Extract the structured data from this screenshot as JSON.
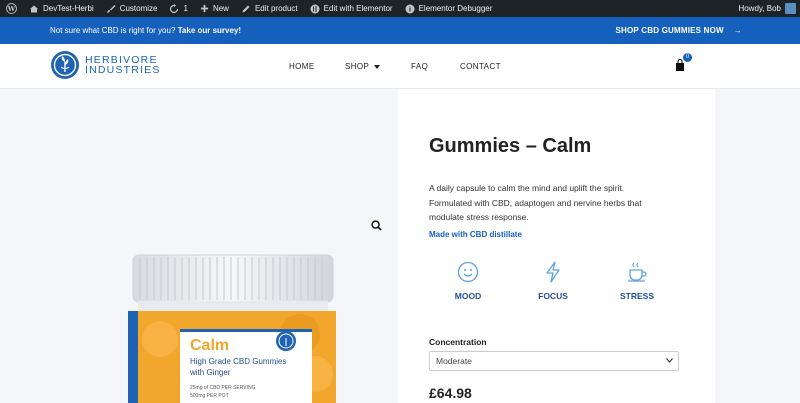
{
  "admin_bar": {
    "site_name": "DevTest-Herbi",
    "customize": "Customize",
    "updates_count": "1",
    "new": "New",
    "edit_product": "Edit product",
    "edit_elementor": "Edit with Elementor",
    "elementor_debugger": "Elementor Debugger",
    "howdy": "Howdy, Bob"
  },
  "promo": {
    "question": "Not sure what CBD is right for you?",
    "survey_link": "Take our survey!",
    "cta": "SHOP CBD GUMMIES NOW",
    "cta_arrow": "→"
  },
  "header": {
    "logo_line1": "HERBIVORE",
    "logo_line2": "INDUSTRIES",
    "nav": {
      "home": "HOME",
      "shop": "SHOP",
      "faq": "FAQ",
      "contact": "CONTACT"
    },
    "cart_count": "0"
  },
  "product": {
    "title": "Gummies – Calm",
    "description": "A daily capsule to calm the mind and uplift the spirit. Formulated with CBD, adaptogen and nervine herbs that modulate stress response.",
    "distillate_label": "Made with CBD distillate",
    "benefits": [
      {
        "label": "MOOD",
        "icon": "smile-icon"
      },
      {
        "label": "FOCUS",
        "icon": "lightning-icon"
      },
      {
        "label": "STRESS",
        "icon": "tea-cup-icon"
      }
    ],
    "concentration_label": "Concentration",
    "concentration_value": "Moderate",
    "price": "£64.98",
    "jar": {
      "name": "Calm",
      "subtitle_line1": "High Grade CBD Gummies",
      "subtitle_line2": "with Ginger",
      "detail_line1": "25mg of CBD PER SERVING",
      "detail_line2": "500mg PER POT"
    }
  },
  "colors": {
    "brand_blue": "#1560bd",
    "admin_bar": "#1d2327",
    "jar_label_orange": "#f2a72c"
  }
}
